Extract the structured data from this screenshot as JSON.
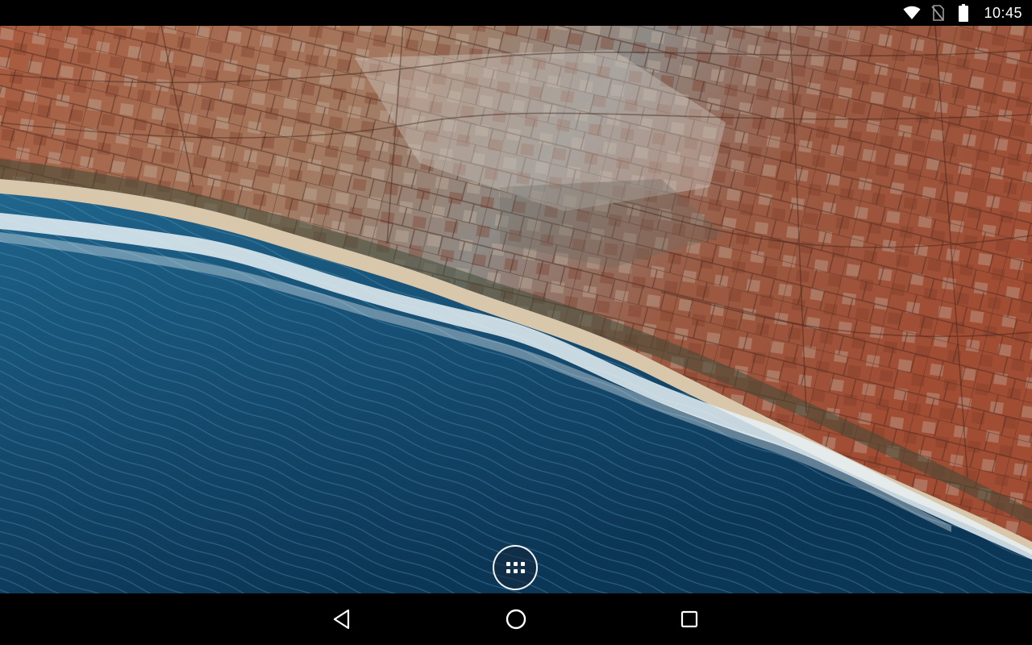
{
  "status_bar": {
    "time": "10:45",
    "icons": [
      "wifi-icon",
      "no-sim-icon",
      "battery-icon"
    ]
  },
  "wallpaper": {
    "description_icon": "satellite-coastline-wallpaper"
  },
  "launcher": {
    "app_drawer_icon": "all-apps-icon"
  },
  "navigation_bar": {
    "buttons": [
      "back-icon",
      "home-icon",
      "recents-icon"
    ]
  },
  "colors": {
    "sea_deep": "#0e3b5e",
    "sea_light": "#2d7aa0",
    "land_red": "#9a4a32",
    "land_tan": "#b88a68",
    "sand": "#d9c6a8",
    "status_bar": "#000000"
  }
}
